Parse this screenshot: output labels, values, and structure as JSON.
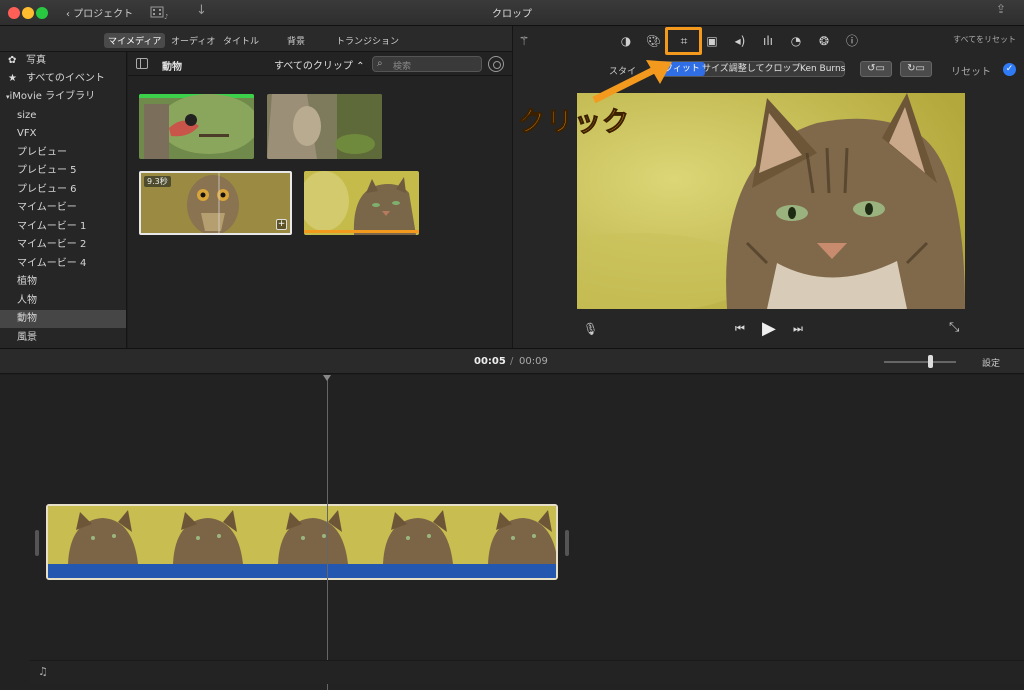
{
  "window": {
    "title": "クロップ",
    "back_label": "プロジェクト"
  },
  "browser_tabs": [
    "マイメディア",
    "オーディオ",
    "タイトル",
    "背景",
    "トランジション"
  ],
  "sidebar": {
    "items": [
      {
        "label": "写真",
        "icon": "gear-flower-icon"
      },
      {
        "label": "すべてのイベント",
        "icon": "star-icon"
      },
      {
        "label": "iMovie ライブラリ"
      },
      {
        "label": "size"
      },
      {
        "label": "VFX"
      },
      {
        "label": "プレビュー"
      },
      {
        "label": "プレビュー 5"
      },
      {
        "label": "プレビュー 6"
      },
      {
        "label": "マイムービー"
      },
      {
        "label": "マイムービー 1"
      },
      {
        "label": "マイムービー 2"
      },
      {
        "label": "マイムービー 4"
      },
      {
        "label": "植物"
      },
      {
        "label": "人物"
      },
      {
        "label": "動物"
      },
      {
        "label": "風景"
      }
    ],
    "selected": "動物"
  },
  "browser": {
    "category": "動物",
    "filter": "すべてのクリップ ⌃",
    "search_placeholder": "検索",
    "selected_clip_duration": "9.3秒"
  },
  "viewer": {
    "reset_all": "すべてをリセット",
    "style_label": "スタイ",
    "crop_modes": [
      "フィット",
      "サイズ調整してクロップ",
      "Ken Burns"
    ],
    "active_mode": "フィット",
    "reset_label": "リセット"
  },
  "annotation": {
    "text": "クリック",
    "color": "#f39a1e"
  },
  "timeline": {
    "current_time": "00:05",
    "separator": "/",
    "total_time": "00:09",
    "settings_label": "設定"
  },
  "colors": {
    "accent_blue": "#2f6ee5",
    "highlight_orange": "#f39a1e",
    "audio_blue": "#2457b0"
  }
}
